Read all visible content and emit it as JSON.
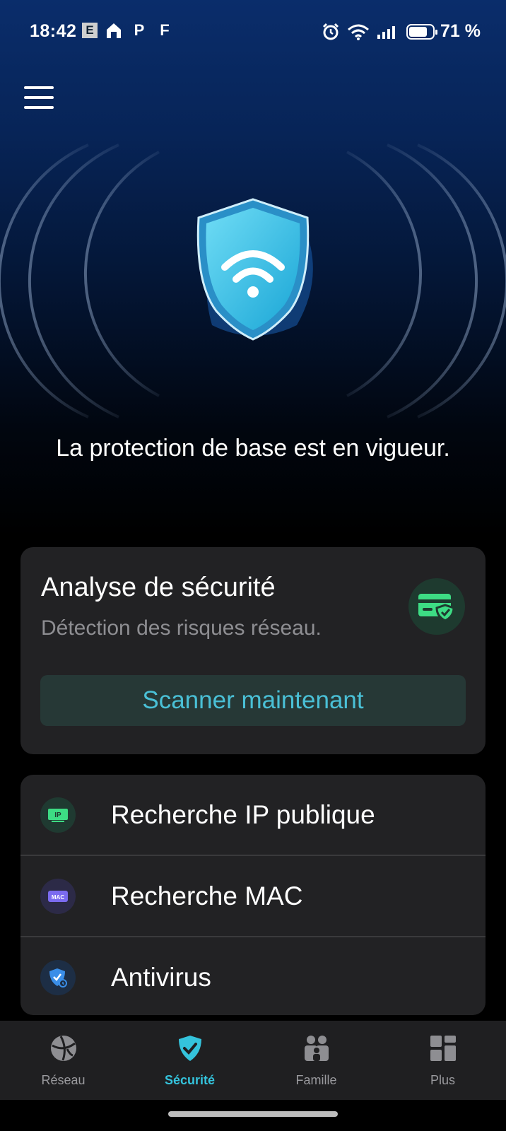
{
  "status_bar": {
    "time": "18:42",
    "notification_icons": [
      "E",
      "⌂",
      "P",
      "F"
    ],
    "battery": "71 %"
  },
  "hero": {
    "title": "La protection de base est en vigueur."
  },
  "scan_card": {
    "title": "Analyse de sécurité",
    "subtitle": "Détection des risques réseau.",
    "button": "Scanner maintenant"
  },
  "tools": [
    {
      "label": "Recherche IP publique",
      "icon": "ip-icon",
      "badge": "IP"
    },
    {
      "label": "Recherche MAC",
      "icon": "mac-icon",
      "badge": "MAC"
    },
    {
      "label": "Antivirus",
      "icon": "antivirus-shield-icon"
    }
  ],
  "nav": [
    {
      "label": "Réseau",
      "icon": "globe-icon"
    },
    {
      "label": "Sécurité",
      "icon": "shield-check-icon",
      "active": true
    },
    {
      "label": "Famille",
      "icon": "family-icon"
    },
    {
      "label": "Plus",
      "icon": "grid-icon"
    }
  ],
  "colors": {
    "accent": "#34c3dc",
    "card": "#222224",
    "scan_badge_green": "#3ddc84",
    "mac_purple": "#7b6bf0",
    "shield_blue": "#3a8ee8"
  }
}
